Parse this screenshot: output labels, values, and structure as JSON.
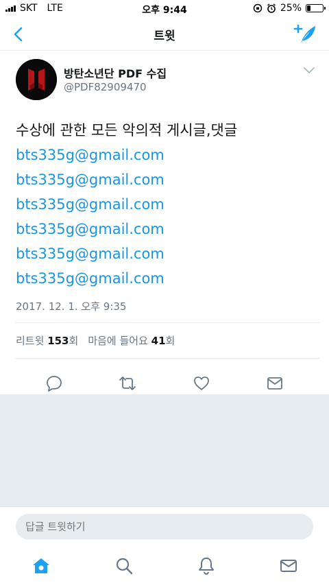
{
  "status_bar": {
    "carrier": "SKT",
    "network": "LTE",
    "time": "오후 9:44",
    "battery_text": "25%",
    "battery_level": 0.25
  },
  "nav": {
    "title": "트윗",
    "back_icon": "chevron-left-icon",
    "compose_icon": "compose-feather-icon"
  },
  "tweet": {
    "user_name": "방탄소년단 PDF 수집",
    "user_handle": "@PDF82909470",
    "text_line": "수상에 관한 모든 악의적 게시글,댓글",
    "links": [
      "bts335g@gmail.com",
      "bts335g@gmail.com",
      "bts335g@gmail.com",
      "bts335g@gmail.com",
      "bts335g@gmail.com",
      "bts335g@gmail.com"
    ],
    "timestamp": "2017. 12. 1. 오후 9:35",
    "retweet_label": "리트윗",
    "retweet_count": "153",
    "count_suffix": "회",
    "like_label": "마음에 들어요",
    "like_count": "41"
  },
  "reply": {
    "placeholder": "답글 트윗하기"
  },
  "tabs": [
    "home-icon",
    "search-icon",
    "notifications-icon",
    "messages-icon"
  ],
  "colors": {
    "accent": "#1da1f2",
    "link": "#1b95e0",
    "muted": "#657786",
    "divider": "#e6ecf0"
  }
}
